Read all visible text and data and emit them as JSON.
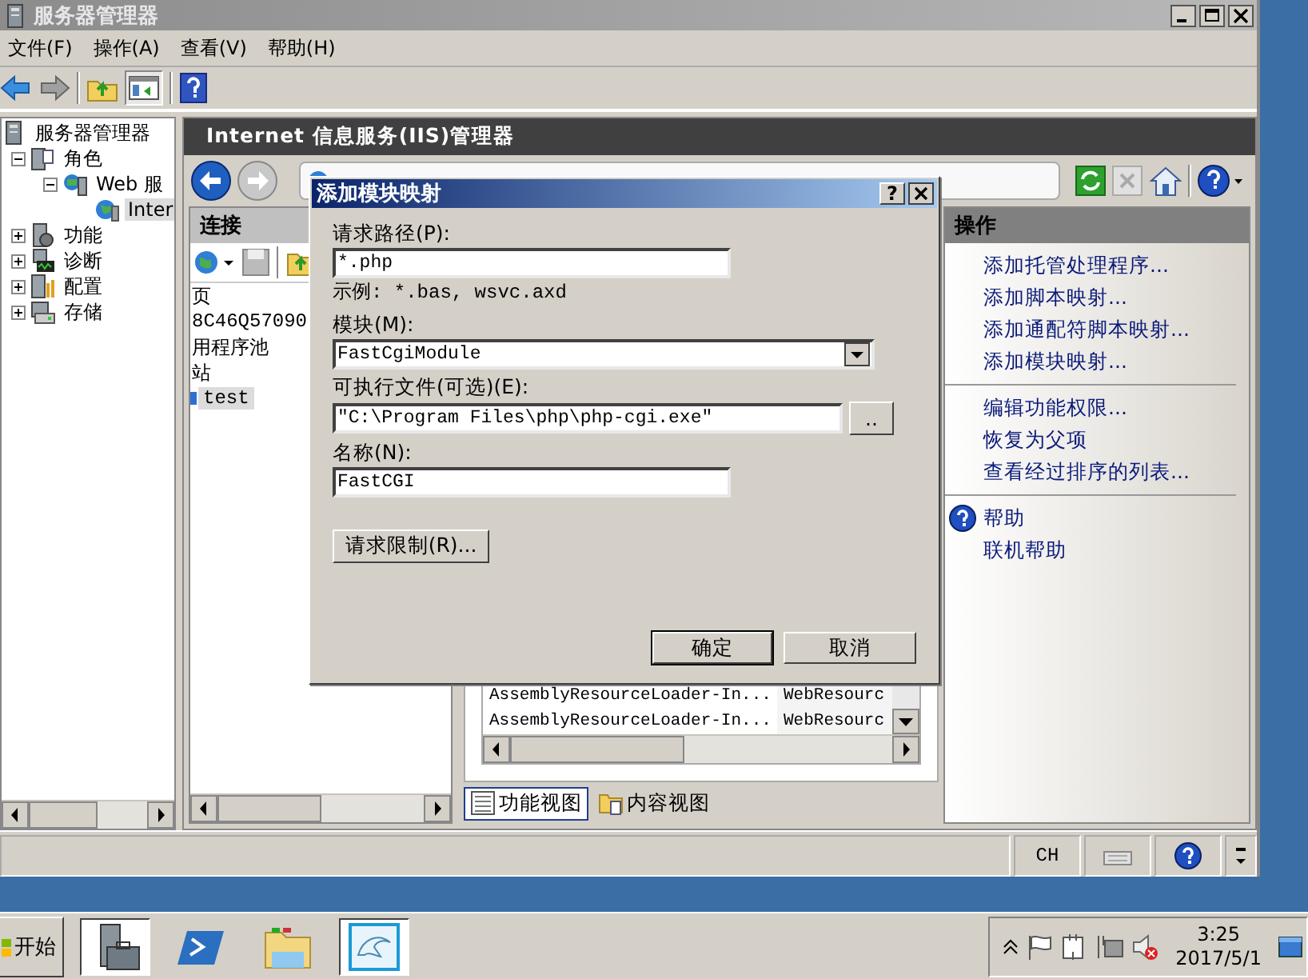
{
  "window": {
    "title": "服务器管理器"
  },
  "menu": [
    {
      "label": "文件(F)"
    },
    {
      "label": "操作(A)"
    },
    {
      "label": "查看(V)"
    },
    {
      "label": "帮助(H)"
    }
  ],
  "tree": [
    {
      "label": "服务器管理器",
      "selected": false,
      "children": [
        {
          "label": "角色",
          "expanded": true,
          "selected": false,
          "children": [
            {
              "label": "Web 服",
              "expanded": true,
              "selected": false,
              "children": [
                {
                  "label": "Inter",
                  "selected": true
                }
              ]
            }
          ]
        },
        {
          "label": "功能",
          "expanded": false,
          "selected": false
        },
        {
          "label": "诊断",
          "expanded": false,
          "selected": false
        },
        {
          "label": "配置",
          "expanded": false,
          "selected": false
        },
        {
          "label": "存储",
          "expanded": false,
          "selected": false
        }
      ]
    }
  ],
  "iis": {
    "title": "Internet 信息服务(IIS)管理器",
    "connections": {
      "title": "连接",
      "items": [
        {
          "label": "页",
          "selected": false
        },
        {
          "label": "8C46Q57090",
          "selected": false
        },
        {
          "label": "用程序池",
          "selected": false
        },
        {
          "label": "站",
          "selected": false
        },
        {
          "label": "test",
          "selected": true
        }
      ]
    },
    "list_rows": [
      [
        "AssemblyResourceLoader-In...",
        "WebResourc"
      ],
      [
        "AssemblyResourceLoader-In...",
        "WebResourc"
      ]
    ],
    "view_tabs": [
      {
        "label": "功能视图",
        "selected": true
      },
      {
        "label": "内容视图",
        "selected": false
      }
    ],
    "actions": {
      "title": "操作",
      "groups": [
        [
          {
            "kind": "link",
            "label": "添加托管处理程序..."
          },
          {
            "kind": "link",
            "label": "添加脚本映射..."
          },
          {
            "kind": "link",
            "label": "添加通配符脚本映射..."
          },
          {
            "kind": "link",
            "label": "添加模块映射..."
          }
        ],
        [
          {
            "kind": "link",
            "label": "编辑功能权限..."
          },
          {
            "kind": "link",
            "label": "恢复为父项"
          },
          {
            "kind": "link",
            "label": "查看经过排序的列表..."
          }
        ],
        [
          {
            "kind": "help",
            "label": "帮助"
          },
          {
            "kind": "link",
            "label": "联机帮助"
          }
        ]
      ]
    }
  },
  "status_bar": {
    "language": "CH"
  },
  "dialog": {
    "title": "添加模块映射",
    "help_button": "?",
    "fields": [
      {
        "kind": "text",
        "label": "请求路径(P):",
        "value": "*.php",
        "note": "示例: *.bas, wsvc.axd"
      },
      {
        "kind": "select",
        "label": "模块(M):",
        "value": "FastCgiModule"
      },
      {
        "kind": "browse",
        "label": "可执行文件(可选)(E):",
        "value": "\"C:\\Program Files\\php\\php-cgi.exe\"",
        "button": ".."
      },
      {
        "kind": "text",
        "label": "名称(N):",
        "value": "FastCGI"
      }
    ],
    "restrict_button": "请求限制(R)...",
    "buttons": [
      {
        "label": "确定",
        "default": true
      },
      {
        "label": "取消",
        "default": false
      }
    ]
  },
  "taskbar": {
    "start": "开始",
    "time": "3:25",
    "date": "2017/5/1"
  }
}
